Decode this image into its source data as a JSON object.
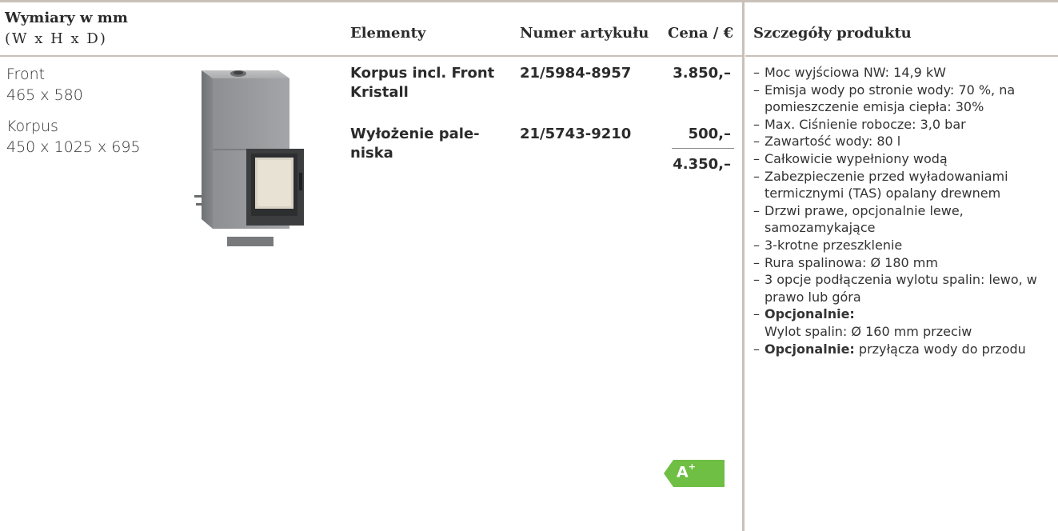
{
  "headers": {
    "dimensions": "Wymiary w mm",
    "dimensions_sub": "(W x H x D)",
    "elements": "Elementy",
    "article": "Numer artykułu",
    "price": "Cena / €",
    "details": "Szczegóły produktu"
  },
  "dimensions": {
    "front_label": "Front",
    "front_value": "465 x 580",
    "korpus_label": "Korpus",
    "korpus_value": "450 x 1025 x 695"
  },
  "rows": [
    {
      "element_line1": "Korpus incl. Front",
      "element_line2": "Kristall",
      "article": "21/5984-8957",
      "price": "3.850,–"
    },
    {
      "element_line1": "Wyłożenie pale-",
      "element_line2": "niska",
      "article": "21/5743-9210",
      "price": "500,–"
    }
  ],
  "total": "4.350,–",
  "details": [
    {
      "text": "Moc wyjściowa NW: 14,9 kW"
    },
    {
      "text": "Emisja wody po stronie wody: 70 %, na pomieszczenie emisja ciepła: 30%"
    },
    {
      "text": "Max. Ciśnienie robocze: 3,0 bar"
    },
    {
      "text": "Zawartość wody: 80 l"
    },
    {
      "text": "Całkowicie wypełniony wodą"
    },
    {
      "text": "Zabezpieczenie przed wyładowaniami termicznymi (TAS) opalany drewnem"
    },
    {
      "text": "Drzwi prawe, opcjonalnie lewe, samozamykające"
    },
    {
      "text": "3-krotne przeszklenie"
    },
    {
      "text": "Rura spalinowa: Ø 180 mm"
    },
    {
      "text": "3 opcje podłączenia wylotu spalin: lewo, w prawo lub góra"
    },
    {
      "bold": "Opcjonalnie:",
      "text": "Wylot spalin: Ø 160 mm przeciw"
    },
    {
      "bold": "Opcjonalnie:",
      "text": "przyłącza wody do przodu"
    }
  ],
  "energy_label": {
    "class": "A",
    "plus": "+",
    "color": "#6fbf44"
  }
}
